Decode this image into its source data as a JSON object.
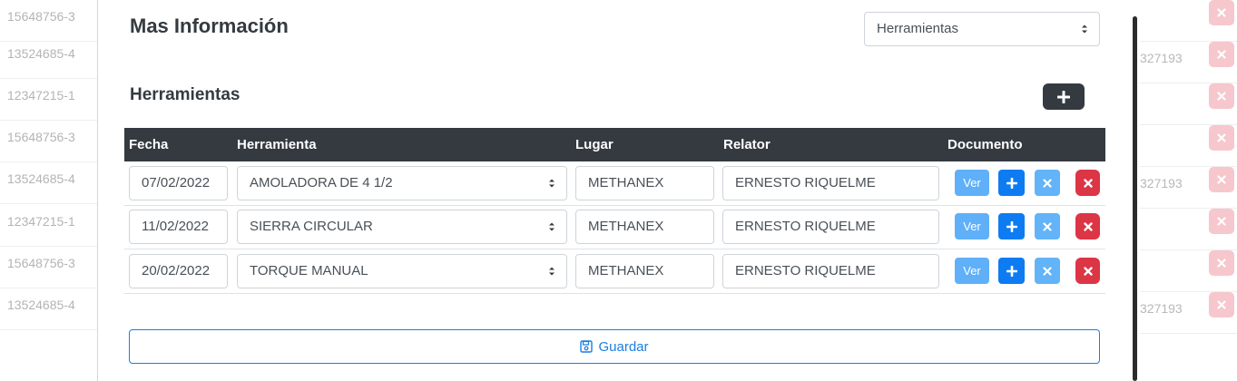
{
  "background": {
    "left_ids": [
      "15648756-3",
      "13524685-4",
      "12347215-1",
      "15648756-3",
      "13524685-4",
      "12347215-1",
      "15648756-3",
      "13524685-4"
    ],
    "right_texts": [
      "",
      "327193",
      "",
      "",
      "327193",
      "",
      "",
      "327193"
    ]
  },
  "modal": {
    "title": "Mas Información",
    "type_select": {
      "value": "Herramientas"
    },
    "section_title": "Herramientas",
    "table": {
      "headers": {
        "fecha": "Fecha",
        "herramienta": "Herramienta",
        "lugar": "Lugar",
        "relator": "Relator",
        "documento": "Documento"
      },
      "rows": [
        {
          "fecha": "07/02/2022",
          "herramienta": "AMOLADORA DE 4 1/2",
          "lugar": "METHANEX",
          "relator": "ERNESTO RIQUELME",
          "ver_label": "Ver"
        },
        {
          "fecha": "11/02/2022",
          "herramienta": "SIERRA CIRCULAR",
          "lugar": "METHANEX",
          "relator": "ERNESTO RIQUELME",
          "ver_label": "Ver"
        },
        {
          "fecha": "20/02/2022",
          "herramienta": "TORQUE MANUAL",
          "lugar": "METHANEX",
          "relator": "ERNESTO RIQUELME",
          "ver_label": "Ver"
        }
      ]
    },
    "save_label": "Guardar"
  },
  "colors": {
    "dark": "#343a40",
    "primary": "#0d7cf2",
    "info_light": "#5fb0f8",
    "danger": "#dc3545",
    "danger_faded": "#f6c7cc"
  },
  "icons": [
    "plus-icon",
    "close-icon",
    "save-icon",
    "select-caret-icon"
  ]
}
